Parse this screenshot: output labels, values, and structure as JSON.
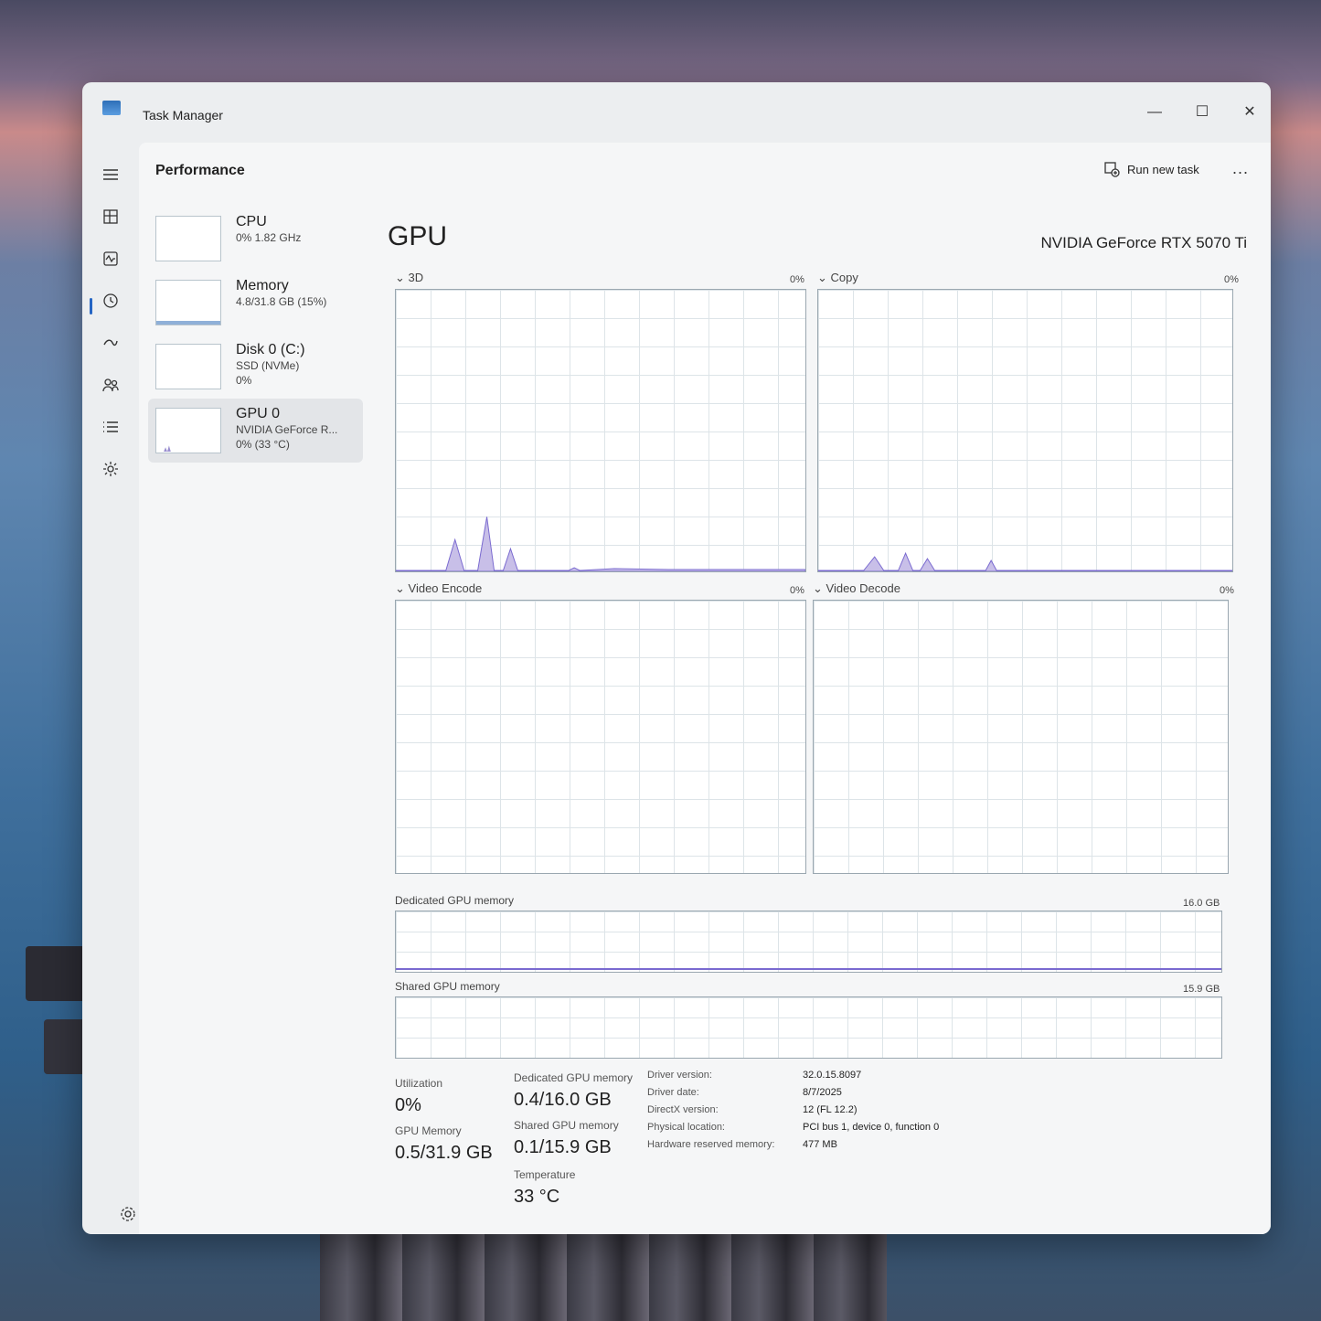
{
  "window": {
    "title": "Task Manager"
  },
  "header": {
    "page_title": "Performance",
    "run_task_label": "Run new task",
    "more_label": "..."
  },
  "nav": {
    "icons": [
      "hamburger-icon",
      "processes-icon",
      "performance-icon",
      "app-history-icon",
      "startup-apps-icon",
      "users-icon",
      "details-icon",
      "services-icon",
      "settings-icon"
    ]
  },
  "sidebar": {
    "items": [
      {
        "name": "CPU",
        "line1": "0% 1.82 GHz",
        "line2": ""
      },
      {
        "name": "Memory",
        "line1": "4.8/31.8 GB (15%)",
        "line2": ""
      },
      {
        "name": "Disk 0 (C:)",
        "line1": "SSD (NVMe)",
        "line2": "0%"
      },
      {
        "name": "GPU 0",
        "line1": "NVIDIA GeForce R...",
        "line2": "0% (33 °C)"
      }
    ]
  },
  "gpu": {
    "title": "GPU",
    "model": "NVIDIA GeForce RTX 5070 Ti",
    "graphs": [
      {
        "label": "3D",
        "pct": "0%"
      },
      {
        "label": "Copy",
        "pct": "0%"
      },
      {
        "label": "Video Encode",
        "pct": "0%"
      },
      {
        "label": "Video Decode",
        "pct": "0%"
      }
    ],
    "dedicated_mem": {
      "label": "Dedicated GPU memory",
      "max": "16.0 GB"
    },
    "shared_mem": {
      "label": "Shared GPU memory",
      "max": "15.9 GB"
    }
  },
  "stats": {
    "utilization_label": "Utilization",
    "utilization_value": "0%",
    "gpu_memory_label": "GPU Memory",
    "gpu_memory_value": "0.5/31.9 GB",
    "dedicated_label": "Dedicated GPU memory",
    "dedicated_value": "0.4/16.0 GB",
    "shared_label": "Shared GPU memory",
    "shared_value": "0.1/15.9 GB",
    "temp_label": "Temperature",
    "temp_value": "33 °C"
  },
  "info": [
    {
      "key": "Driver version:",
      "value": "32.0.15.8097"
    },
    {
      "key": "Driver date:",
      "value": "8/7/2025"
    },
    {
      "key": "DirectX version:",
      "value": "12 (FL 12.2)"
    },
    {
      "key": "Physical location:",
      "value": "PCI bus 1, device 0, function 0"
    },
    {
      "key": "Hardware reserved memory:",
      "value": "477 MB"
    }
  ],
  "colors": {
    "accent": "#2565c4",
    "graph_line": "#7a6ad0",
    "graph_fill": "#c8bfe8"
  }
}
